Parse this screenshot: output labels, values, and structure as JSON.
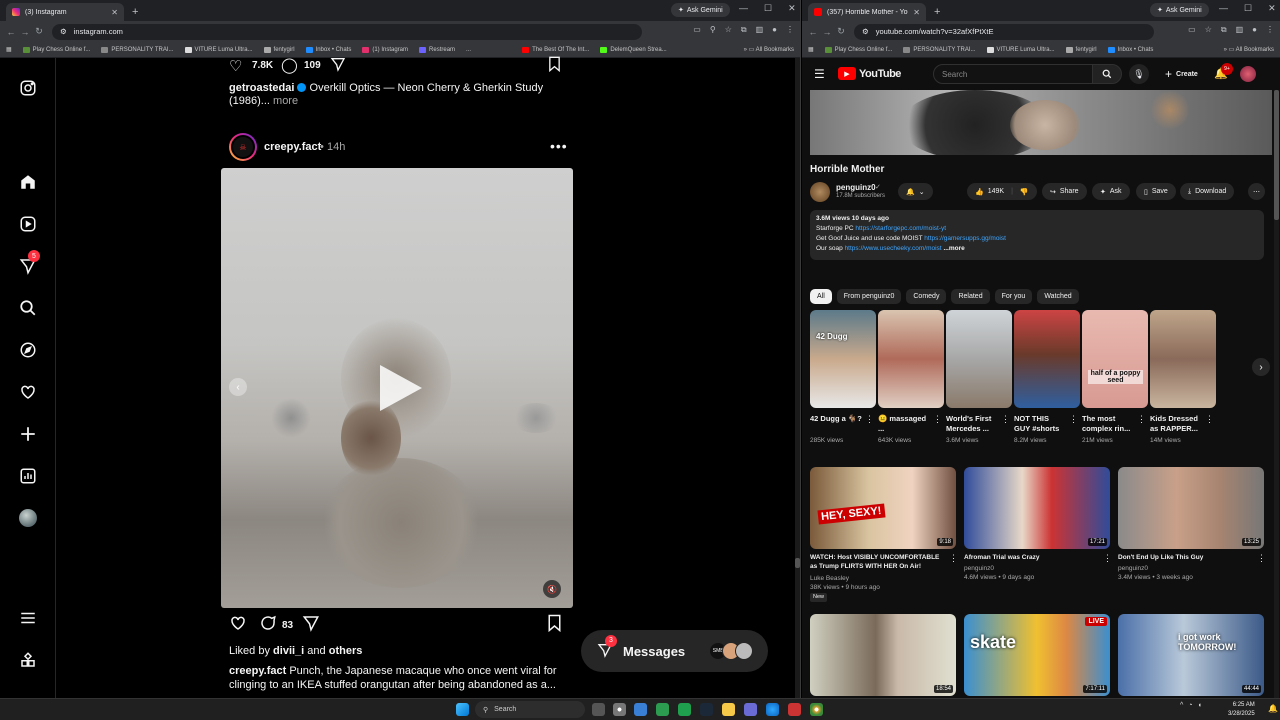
{
  "left_window": {
    "tab_title": "(3) Instagram",
    "ask_gemini": "Ask Gemini",
    "url": "instagram.com",
    "bookmarks": [
      "Play Chess Online f...",
      "PERSONALITY TRAI...",
      "VITURE Luma Ultra...",
      "fentygirl",
      "Inbox • Chats",
      "(1) Instagram",
      "Restream",
      "...",
      "The Best Of The Int...",
      "DelemQueen Strea..."
    ],
    "all_bookmarks": "All Bookmarks"
  },
  "instagram": {
    "prev_post": {
      "likes": "7.8K",
      "comments": "109",
      "author": "getroastedai",
      "caption": "Overkill Optics — Neon Cherry & Gherkin Study",
      "caption_line2": "(1986)...",
      "more": "more"
    },
    "post": {
      "author": "creepy.fact",
      "time": "14h",
      "comments": "83",
      "liked_by_prefix": "Liked by",
      "liked_by_user": "divii_i",
      "liked_by_and": "and",
      "liked_by_others": "others",
      "caption_author": "creepy.fact",
      "caption_line1": "Punch, the Japanese macaque who once went viral for",
      "caption_line2": "clinging to an IKEA stuffed orangutan after being abandoned as a..."
    },
    "notifications_badge": "5",
    "messages": {
      "label": "Messages",
      "badge": "3"
    }
  },
  "right_window": {
    "tab_title": "(357) Horrible Mother - YouTub...",
    "ask_gemini": "Ask Gemini",
    "url": "youtube.com/watch?v=32afXfPtXtE",
    "bookmarks": [
      "Play Chess Online f...",
      "PERSONALITY TRAI...",
      "VITURE Luma Ultra...",
      "fentygirl",
      "Inbox • Chats"
    ],
    "all_bookmarks": "All Bookmarks"
  },
  "youtube": {
    "logo": "YouTube",
    "search_placeholder": "Search",
    "create": "Create",
    "notif_badge": "9+",
    "video_title": "Horrible Mother",
    "channel": "penguinz0",
    "subscribers": "17.8M subscribers",
    "likes": "149K",
    "share": "Share",
    "ask": "Ask",
    "save": "Save",
    "download": "Download",
    "desc_stats": "3.6M views  10 days ago",
    "desc_lines": [
      {
        "label": "Starforge PC",
        "link": "https://starforgepc.com/moist-yt"
      },
      {
        "label": "Get Goof Juice and use code MOIST",
        "link": "https://gamersupps.gg/moist"
      },
      {
        "label": "Our soap",
        "link": "https://www.usecheeky.com/moist"
      }
    ],
    "desc_more": "...more",
    "chips": [
      "All",
      "From penguinz0",
      "Comedy",
      "Related",
      "For you",
      "Watched"
    ],
    "shorts": [
      {
        "title": "42 Dugg a 🐐?",
        "views": "285K views",
        "overlay": "42 Dugg"
      },
      {
        "title": "😐 massaged ...",
        "views": "643K views",
        "overlay": ""
      },
      {
        "title": "World's First Mercedes ...",
        "views": "3.6M views",
        "overlay": ""
      },
      {
        "title": "NOT THIS GUY #shorts",
        "views": "8.2M views",
        "overlay": ""
      },
      {
        "title": "The most complex rin...",
        "views": "21M views",
        "overlay": "half of a poppy seed"
      },
      {
        "title": "Kids Dressed as RAPPER...",
        "views": "14M views",
        "overlay": ""
      }
    ],
    "videos": [
      {
        "title": "WATCH: Host VISIBLY UNCOMFORTABLE as Trump FLIRTS WITH HER On Air!",
        "channel": "Luke Beasley",
        "meta": "38K views • 9 hours ago",
        "duration": "9:18",
        "badge": "New",
        "overlay": "HEY, SEXY!"
      },
      {
        "title": "Afroman Trial was Crazy",
        "channel": "penguinz0",
        "meta": "4.6M views • 9 days ago",
        "duration": "17:21",
        "badge": "",
        "overlay": ""
      },
      {
        "title": "Don't End Up Like This Guy",
        "channel": "penguinz0",
        "meta": "3.4M views • 3 weeks ago",
        "duration": "13:25",
        "badge": "",
        "overlay": ""
      },
      {
        "title": "",
        "channel": "",
        "meta": "",
        "duration": "18:54",
        "badge": "",
        "overlay": ""
      },
      {
        "title": "",
        "channel": "",
        "meta": "",
        "duration": "7:17:11",
        "badge": "LIVE",
        "overlay": "skate"
      },
      {
        "title": "",
        "channel": "",
        "meta": "",
        "duration": "44:44",
        "badge": "",
        "overlay": "i got work TOMORROW!"
      }
    ]
  },
  "taskbar": {
    "search": "Search",
    "time": "6:25 AM",
    "date": "3/28/2025"
  },
  "colors": {
    "ig_badge": "#ff3040",
    "yt_red": "#ff0000",
    "link": "#3ea6ff"
  }
}
